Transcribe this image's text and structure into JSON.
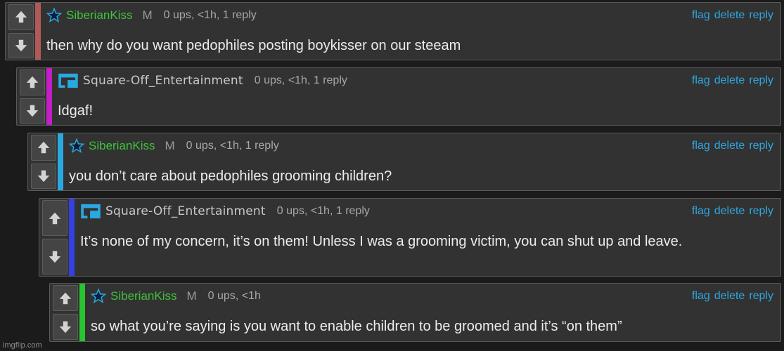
{
  "actions": {
    "flag": "flag",
    "delete": "delete",
    "reply": "reply"
  },
  "comments": [
    {
      "username": "SiberianKiss",
      "badge": "M",
      "meta": "0 ups, <1h, 1 reply",
      "text": "then why do you want pedophiles posting boykisser on our steeam",
      "bar_color": "#b25a5a",
      "avatar": "star-icon"
    },
    {
      "username": "Square-Off_Entertainment",
      "badge": "",
      "meta": "0 ups, <1h, 1 reply",
      "text": "Idgaf!",
      "bar_color": "#c21fc4",
      "avatar": "square-off-logo-icon"
    },
    {
      "username": "SiberianKiss",
      "badge": "M",
      "meta": "0 ups, <1h, 1 reply",
      "text": "you don’t care about pedophiles grooming children?",
      "bar_color": "#2aa8e0",
      "avatar": "star-icon"
    },
    {
      "username": "Square-Off_Entertainment",
      "badge": "",
      "meta": "0 ups, <1h, 1 reply",
      "text": "It’s none of my concern, it’s on them! Unless I was a grooming victim, you can shut up and leave.",
      "bar_color": "#3440e0",
      "avatar": "square-off-logo-icon"
    },
    {
      "username": "SiberianKiss",
      "badge": "M",
      "meta": "0 ups, <1h",
      "text": "so what you’re saying is you want to enable children to be groomed and it’s “on them”",
      "bar_color": "#28c431",
      "avatar": "star-icon"
    }
  ],
  "watermark": "imgflip.com"
}
